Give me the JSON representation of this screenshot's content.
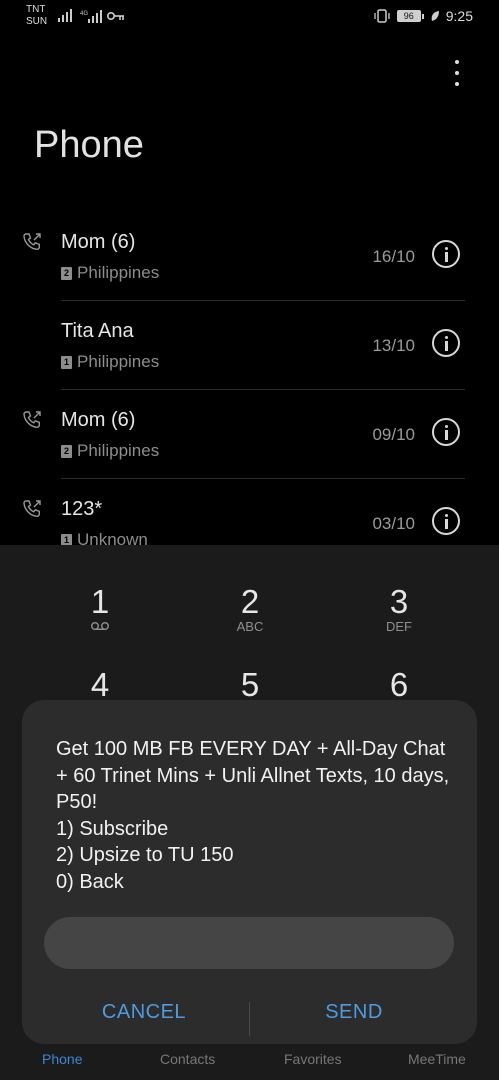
{
  "status_bar": {
    "carrier_1": "TNT",
    "carrier_2": "SUN",
    "battery": "96",
    "time": "9:25",
    "icons": [
      "signal-icon",
      "signal-icon",
      "key-icon",
      "vibrate-icon",
      "battery-icon",
      "leaf-icon"
    ]
  },
  "header": {
    "title": "Phone",
    "menu_icon": "more-vertical-icon"
  },
  "call_log": [
    {
      "name": "Mom (6)",
      "sim": "2",
      "location": "Philippines",
      "date": "16/10",
      "outgoing": true
    },
    {
      "name": "Tita Ana",
      "sim": "1",
      "location": "Philippines",
      "date": "13/10",
      "outgoing": false
    },
    {
      "name": "Mom (6)",
      "sim": "2",
      "location": "Philippines",
      "date": "09/10",
      "outgoing": true
    },
    {
      "name": "123*",
      "sim": "1",
      "location": "Unknown",
      "date": "03/10",
      "outgoing": true
    }
  ],
  "dialpad": {
    "keys": [
      {
        "digit": "1",
        "letters": "voicemail-icon"
      },
      {
        "digit": "2",
        "letters": "ABC"
      },
      {
        "digit": "3",
        "letters": "DEF"
      },
      {
        "digit": "4",
        "letters": ""
      },
      {
        "digit": "5",
        "letters": ""
      },
      {
        "digit": "6",
        "letters": ""
      }
    ]
  },
  "bottom_nav": {
    "items": [
      "Phone",
      "Contacts",
      "Favorites",
      "MeeTime"
    ],
    "active": "Phone"
  },
  "dialog": {
    "message": "Get 100 MB FB EVERY DAY + All-Day Chat + 60 Trinet Mins + Unli Allnet Texts, 10 days, P50!\n1) Subscribe\n2) Upsize to TU 150\n0) Back",
    "input_value": "",
    "cancel_label": "CANCEL",
    "send_label": "SEND"
  },
  "colors": {
    "accent": "#4f9be0",
    "background": "#000000",
    "dialog": "#2c2c2c"
  }
}
